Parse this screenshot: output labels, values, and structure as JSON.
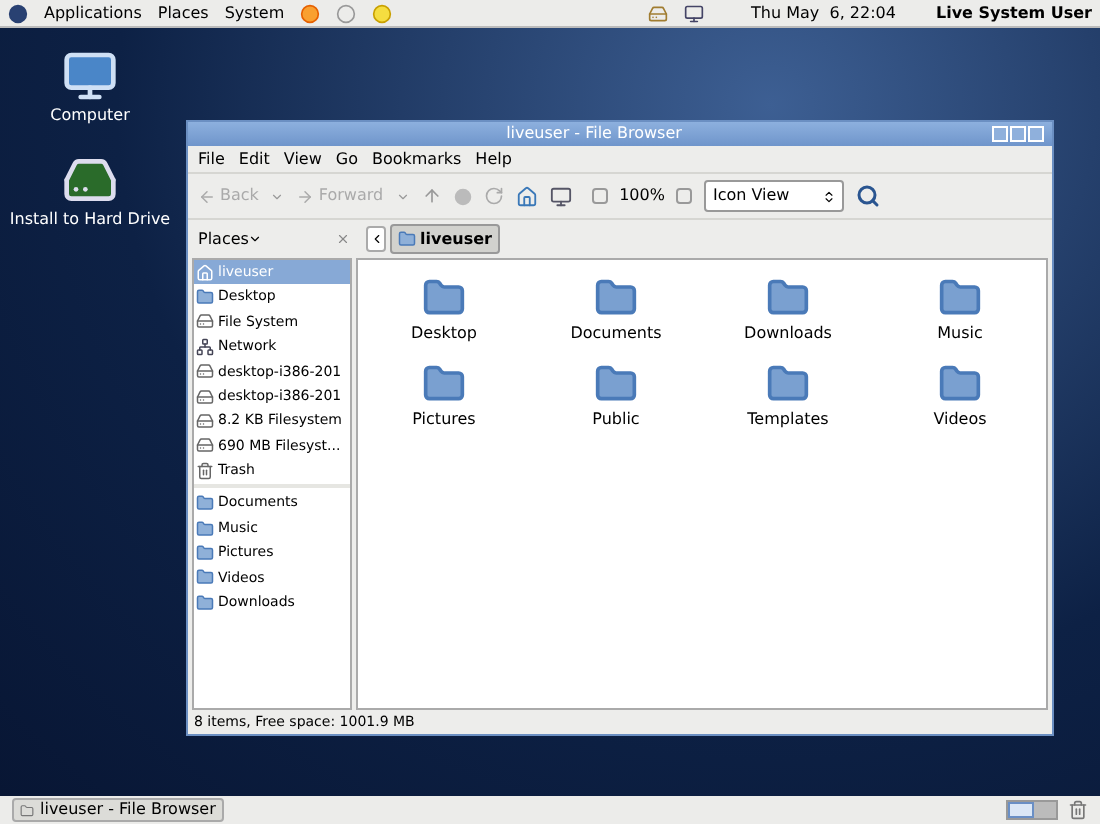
{
  "top_panel": {
    "menus": [
      "Applications",
      "Places",
      "System"
    ],
    "clock": "Thu May  6, 22:04",
    "user": "Live System User"
  },
  "desktop_icons": [
    {
      "label": "Computer",
      "kind": "computer"
    },
    {
      "label": "Install to Hard Drive",
      "kind": "install"
    }
  ],
  "window": {
    "title": "liveuser - File Browser",
    "menu": [
      "File",
      "Edit",
      "View",
      "Go",
      "Bookmarks",
      "Help"
    ],
    "toolbar": {
      "back": {
        "label": "Back",
        "disabled": true
      },
      "forward": {
        "label": "Forward",
        "disabled": true
      },
      "zoom": "100%",
      "view": "Icon View"
    },
    "sidebar": {
      "title": "Places",
      "groups": [
        [
          {
            "label": "liveuser",
            "kind": "home",
            "selected": true
          },
          {
            "label": "Desktop",
            "kind": "folder",
            "selected": false
          },
          {
            "label": "File System",
            "kind": "drive",
            "selected": false
          },
          {
            "label": "Network",
            "kind": "network",
            "selected": false
          },
          {
            "label": "desktop-i386-201",
            "kind": "drive",
            "selected": false
          },
          {
            "label": "desktop-i386-201",
            "kind": "drive",
            "selected": false
          },
          {
            "label": "8.2 KB Filesystem",
            "kind": "drive",
            "selected": false
          },
          {
            "label": "690 MB Filesyst...",
            "kind": "drive",
            "selected": false
          },
          {
            "label": "Trash",
            "kind": "trash",
            "selected": false
          }
        ],
        [
          {
            "label": "Documents",
            "kind": "folder",
            "selected": false
          },
          {
            "label": "Music",
            "kind": "folder",
            "selected": false
          },
          {
            "label": "Pictures",
            "kind": "folder",
            "selected": false
          },
          {
            "label": "Videos",
            "kind": "folder",
            "selected": false
          },
          {
            "label": "Downloads",
            "kind": "folder",
            "selected": false
          }
        ]
      ]
    },
    "path": "liveuser",
    "files": [
      "Desktop",
      "Documents",
      "Downloads",
      "Music",
      "Pictures",
      "Public",
      "Templates",
      "Videos"
    ],
    "status": "8 items, Free space: 1001.9 MB"
  },
  "taskbar": [
    {
      "label": "liveuser - File Browser"
    }
  ]
}
